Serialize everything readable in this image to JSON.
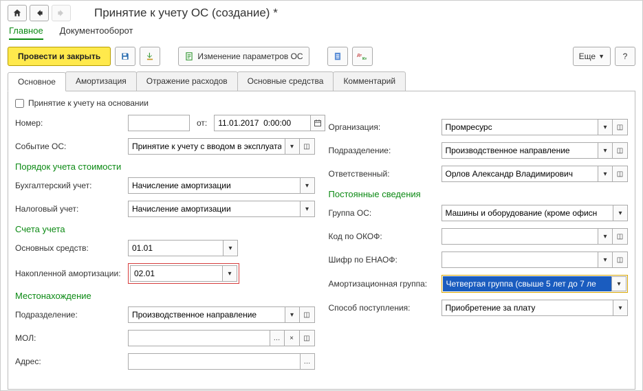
{
  "header": {
    "title": "Принятие к учету ОС (создание) *"
  },
  "navTabs": {
    "main": "Главное",
    "docFlow": "Документооборот"
  },
  "toolbar": {
    "postAndClose": "Провести и закрыть",
    "changeParams": "Изменение параметров ОС",
    "more": "Еще",
    "help": "?"
  },
  "tabs": {
    "main": "Основное",
    "depreciation": "Амортизация",
    "expenses": "Отражение расходов",
    "fixedAssets": "Основные средства",
    "comment": "Комментарий"
  },
  "left": {
    "basedOn": {
      "label": "Принятие к учету на основании"
    },
    "number": {
      "label": "Номер:",
      "value": "",
      "fromLabel": "от:",
      "date": "11.01.2017  0:00:00"
    },
    "eventOS": {
      "label": "Событие ОС:",
      "value": "Принятие к учету с вводом в эксплуата"
    },
    "section_cost": "Порядок учета стоимости",
    "accAccounting": {
      "label": "Бухгалтерский учет:",
      "value": "Начисление амортизации"
    },
    "taxAccounting": {
      "label": "Налоговый учет:",
      "value": "Начисление амортизации"
    },
    "section_accounts": "Счета учета",
    "fixedAssetsAcc": {
      "label": "Основных средств:",
      "value": "01.01"
    },
    "accumDepr": {
      "label": "Накопленной амортизации:",
      "value": "02.01"
    },
    "section_location": "Местонахождение",
    "subdivision": {
      "label": "Подразделение:",
      "value": "Производственное направление"
    },
    "mol": {
      "label": "МОЛ:",
      "value": ""
    },
    "address": {
      "label": "Адрес:",
      "value": ""
    }
  },
  "right": {
    "organization": {
      "label": "Организация:",
      "value": "Промресурс"
    },
    "subdivision": {
      "label": "Подразделение:",
      "value": "Производственное направление"
    },
    "responsible": {
      "label": "Ответственный:",
      "value": "Орлов Александр Владимирович"
    },
    "section_perm": "Постоянные сведения",
    "groupOS": {
      "label": "Группа ОС:",
      "value": "Машины и оборудование (кроме офисн"
    },
    "okof": {
      "label": "Код по ОКОФ:",
      "value": ""
    },
    "enaof": {
      "label": "Шифр по ЕНАОФ:",
      "value": ""
    },
    "amortGroup": {
      "label": "Амортизационная группа:",
      "value": "Четвертая группа (свыше 5 лет до 7 ле"
    },
    "acqMethod": {
      "label": "Способ поступления:",
      "value": "Приобретение за плату"
    }
  }
}
